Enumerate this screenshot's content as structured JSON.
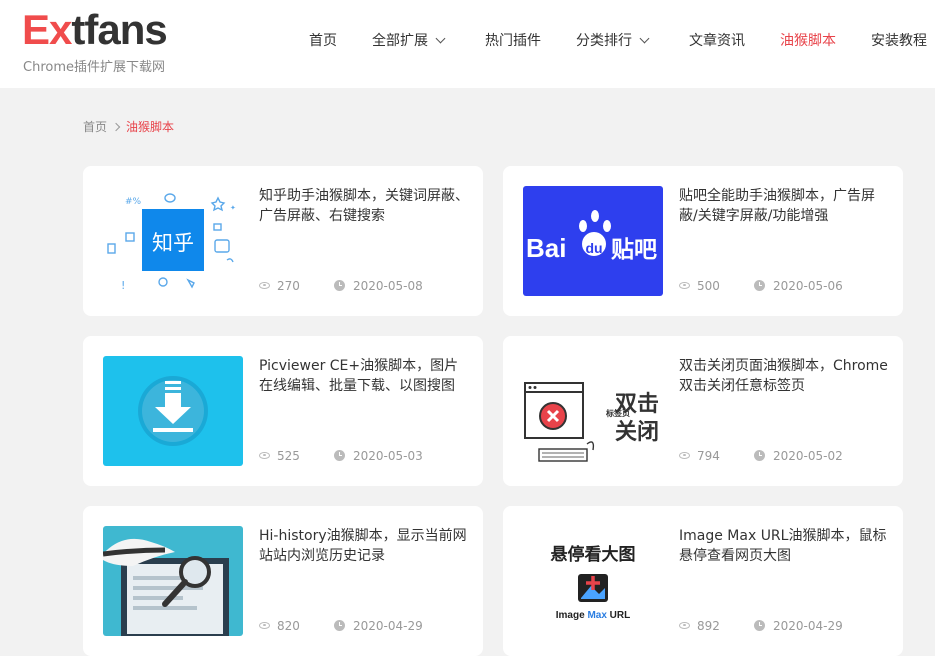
{
  "header": {
    "logo_ex": "Ex",
    "logo_rest": "tfans",
    "tagline": "Chrome插件扩展下载网",
    "nav": [
      {
        "label": "首页"
      },
      {
        "label": "全部扩展"
      },
      {
        "label": "热门插件"
      },
      {
        "label": "分类排行"
      },
      {
        "label": "文章资讯"
      },
      {
        "label": "油猴脚本"
      },
      {
        "label": "安装教程"
      }
    ]
  },
  "breadcrumb": {
    "home": "首页",
    "current": "油猴脚本"
  },
  "cards": [
    {
      "title": "知乎助手油猴脚本，关键词屏蔽、广告屏蔽、右键搜索",
      "views": "270",
      "date": "2020-05-08",
      "thumb_text": "知乎"
    },
    {
      "title": "贴吧全能助手油猴脚本，广告屏蔽/关键字屏蔽/功能增强",
      "views": "500",
      "date": "2020-05-06",
      "thumb_text_a": "Bai",
      "thumb_text_b": "du",
      "thumb_text_c": "贴吧"
    },
    {
      "title": "Picviewer CE+油猴脚本，图片在线编辑、批量下载、以图搜图",
      "views": "525",
      "date": "2020-05-03"
    },
    {
      "title": "双击关闭页面油猴脚本，Chrome双击关闭任意标签页",
      "views": "794",
      "date": "2020-05-02",
      "thumb_text_small": "标签页",
      "thumb_text_big1": "双击",
      "thumb_text_big2": "关闭"
    },
    {
      "title": "Hi-history油猴脚本，显示当前网站站内浏览历史记录",
      "views": "820",
      "date": "2020-04-29"
    },
    {
      "title": "Image Max URL油猴脚本，鼠标悬停查看网页大图",
      "views": "892",
      "date": "2020-04-29",
      "thumb_text_top": "悬停看大图",
      "thumb_text_image": "Image ",
      "thumb_text_max": "Max",
      "thumb_text_url": " URL"
    }
  ],
  "colors": {
    "accent": "#e8434a",
    "baidu_blue": "#2e3fee",
    "picviewer_cyan": "#1ec1ec",
    "zhihu_blue": "#0f88eb"
  }
}
